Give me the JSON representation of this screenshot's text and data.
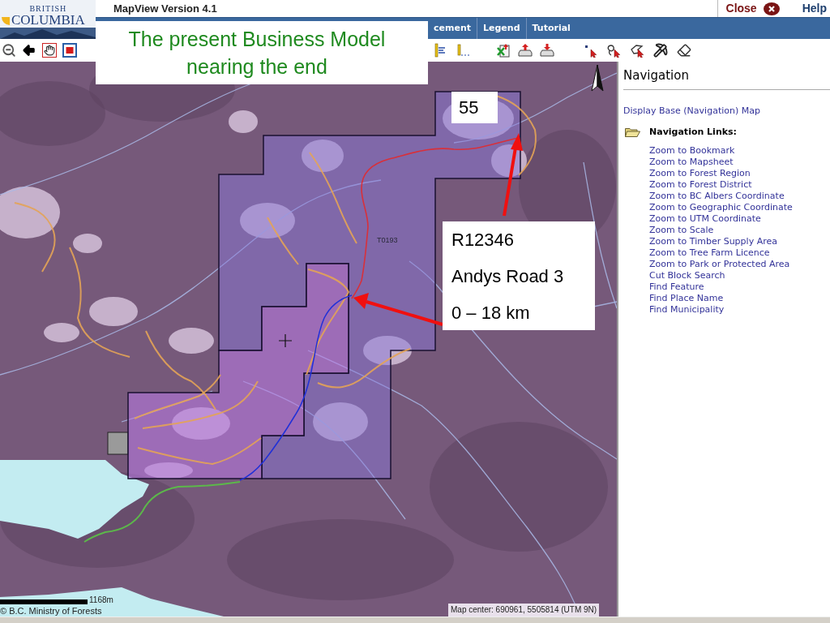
{
  "header": {
    "logo": {
      "line_1": "BRITISH",
      "line_2": "COLUMBIA"
    },
    "title": "MapView Version 4.1",
    "close_button": "Close",
    "help_link": "Help"
  },
  "menu_bar": {
    "items": [
      "cement",
      "Legend",
      "Tutorial"
    ]
  },
  "slide_title": {
    "lines": [
      "The present Business Model",
      "nearing the end"
    ]
  },
  "map": {
    "block_label": "T0193",
    "callouts": [
      {
        "lines": [
          "55"
        ]
      },
      {
        "lines": [
          "R12346",
          "Andys Road 3",
          "0 – 18 km"
        ]
      }
    ],
    "scale_label": "1168m",
    "copyright": "© B.C. Ministry of Forests",
    "map_center": "Map center: 690961, 5505814 (UTM 9N)"
  },
  "navigation": {
    "title": "Navigation",
    "base_map_link": "Display Base (Navigation) Map",
    "links_heading": "Navigation Links:",
    "links": [
      "Zoom to Bookmark",
      "Zoom to Mapsheet",
      "Zoom to Forest Region",
      "Zoom to Forest District",
      "Zoom to BC Albers Coordinate",
      "Zoom to Geographic Coordinate",
      "Zoom to UTM Coordinate",
      "Zoom to Scale",
      "Zoom to Timber Supply Area",
      "Zoom to Tree Farm Licence",
      "Zoom to Park or Protected Area",
      "Cut Block Search",
      "Find Feature",
      "Find Place Name",
      "Find Municipality"
    ]
  }
}
